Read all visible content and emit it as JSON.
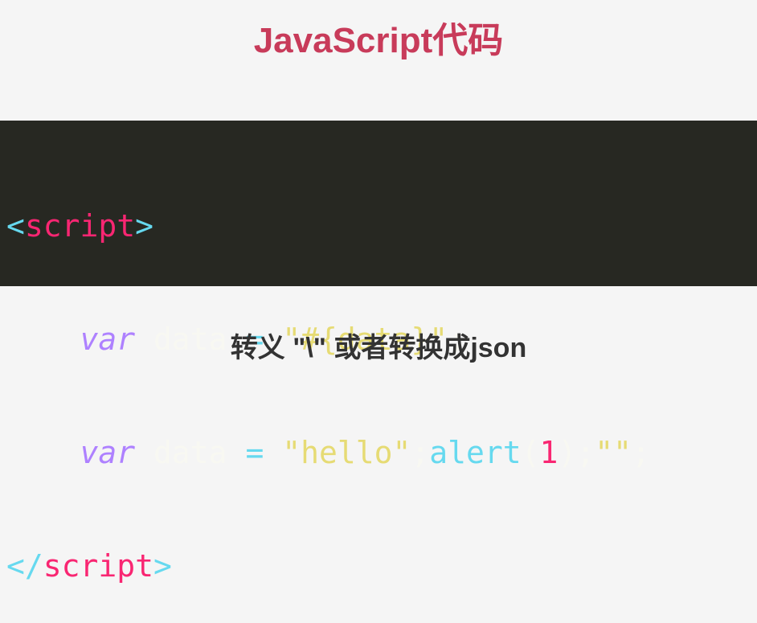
{
  "title": "JavaScript代码",
  "code": {
    "line1": {
      "open": "<",
      "tag": "script",
      "close": ">"
    },
    "line2": {
      "indent": "    ",
      "kw": "var",
      "sp1": " ",
      "ident": "data",
      "eq": " = ",
      "str": "\"#{data}\"",
      "semi": ";"
    },
    "line3": {
      "indent": "    ",
      "kw": "var",
      "sp1": " ",
      "ident": "data",
      "eq": " = ",
      "str": "\"hello\"",
      "semi1": ";",
      "fn": "alert",
      "paren_open": "(",
      "num": "1",
      "paren_close": ")",
      "semi2": ";",
      "str2": "\"\"",
      "semi3": ";"
    },
    "line4": {
      "open": "</",
      "tag": "script",
      "close": ">"
    }
  },
  "caption": "转义 \"\\\" 或者转换成json",
  "colors": {
    "title": "#c83b5a",
    "code_bg": "#272822",
    "page_bg": "#f5f5f5",
    "caption": "#333333"
  }
}
